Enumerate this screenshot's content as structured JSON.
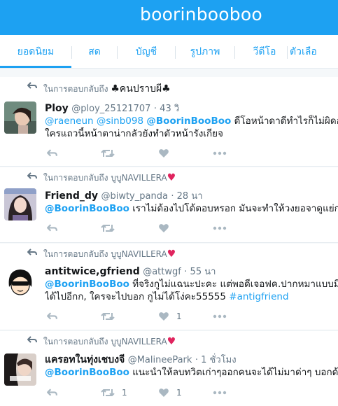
{
  "app": {
    "title": "boorinbooboo"
  },
  "tabs": [
    {
      "label": "ยอดนิยม",
      "active": true
    },
    {
      "label": "สด"
    },
    {
      "label": "บัญชี"
    },
    {
      "label": "รูปภาพ"
    },
    {
      "label": "วีดีโอ"
    },
    {
      "label": "ตัวเลือ"
    }
  ],
  "tweets": [
    {
      "reply_prefix": "ในการตอบกลับถึง",
      "reply_to": "♣คนปราบผี♣",
      "display_name": "Ploy",
      "handle": "@ploy_25121707",
      "time": "· 43 วิ",
      "line1_mentions": "@raeneun @sinb098",
      "line1_mention_main": "@BoorinBooBoo",
      "line1_text": "ดีโอหน้าดาดีทำไรก็ไม่ผิดอะ",
      "line2_text": "ใครแถวนี้หน้าตาน่ากลัวยังทำตัวหน้ารังเกียจ",
      "retweet_count": "",
      "like_count": ""
    },
    {
      "reply_prefix": "ในการตอบกลับถึง",
      "reply_to": "บูบูNAVILLERA",
      "reply_heart": "♥",
      "display_name": "Friend_dy",
      "handle": "@biwty_panda",
      "time": "· 28 นา",
      "line1_mention_main": "@BoorinBooBoo",
      "line1_text": "เราไม่ต้องไปโต้ตอบหรอก มันจะทำให้วงยอจาดูแย่กว่า",
      "retweet_count": "",
      "like_count": ""
    },
    {
      "reply_prefix": "ในการตอบกลับถึง",
      "reply_to": "บูบูNAVILLERA",
      "reply_heart": "♥",
      "display_name": "antitwice,gfriend",
      "handle": "@attwgf",
      "time": "· 55 นา",
      "line1_mention_main": "@BoorinBooBoo",
      "line1_text": "ที่จริงกูไม่แฉนะปะคะ แต่พอดีเจอฟค.ปากหมาแบบมึงกู",
      "line2_text": "ได้ไปอีกก, ใครจะไปบอก กูไม่ได้โง่คะ55555",
      "line2_hashtag": "#antigfriend",
      "retweet_count": "",
      "like_count": "1"
    },
    {
      "reply_prefix": "ในการตอบกลับถึง",
      "reply_to": "บูบูNAVILLERA",
      "reply_heart": "♥",
      "display_name": "แครอทในทุ่งเชบงจี",
      "handle": "@MalineePark",
      "time": "· 1 ชั่วโมง",
      "line1_mention_main": "@BoorinBooBoo",
      "line1_text": "แนะนำให้ลบทวิตเก่าๆออกคนจะได้ไม่มาด่าๆ บอกด้วย",
      "retweet_count": "1",
      "like_count": "1"
    }
  ],
  "colors": {
    "accent": "#1da1f2",
    "heart": "#e0245e",
    "muted": "#657786",
    "icon": "#aab8c2"
  }
}
